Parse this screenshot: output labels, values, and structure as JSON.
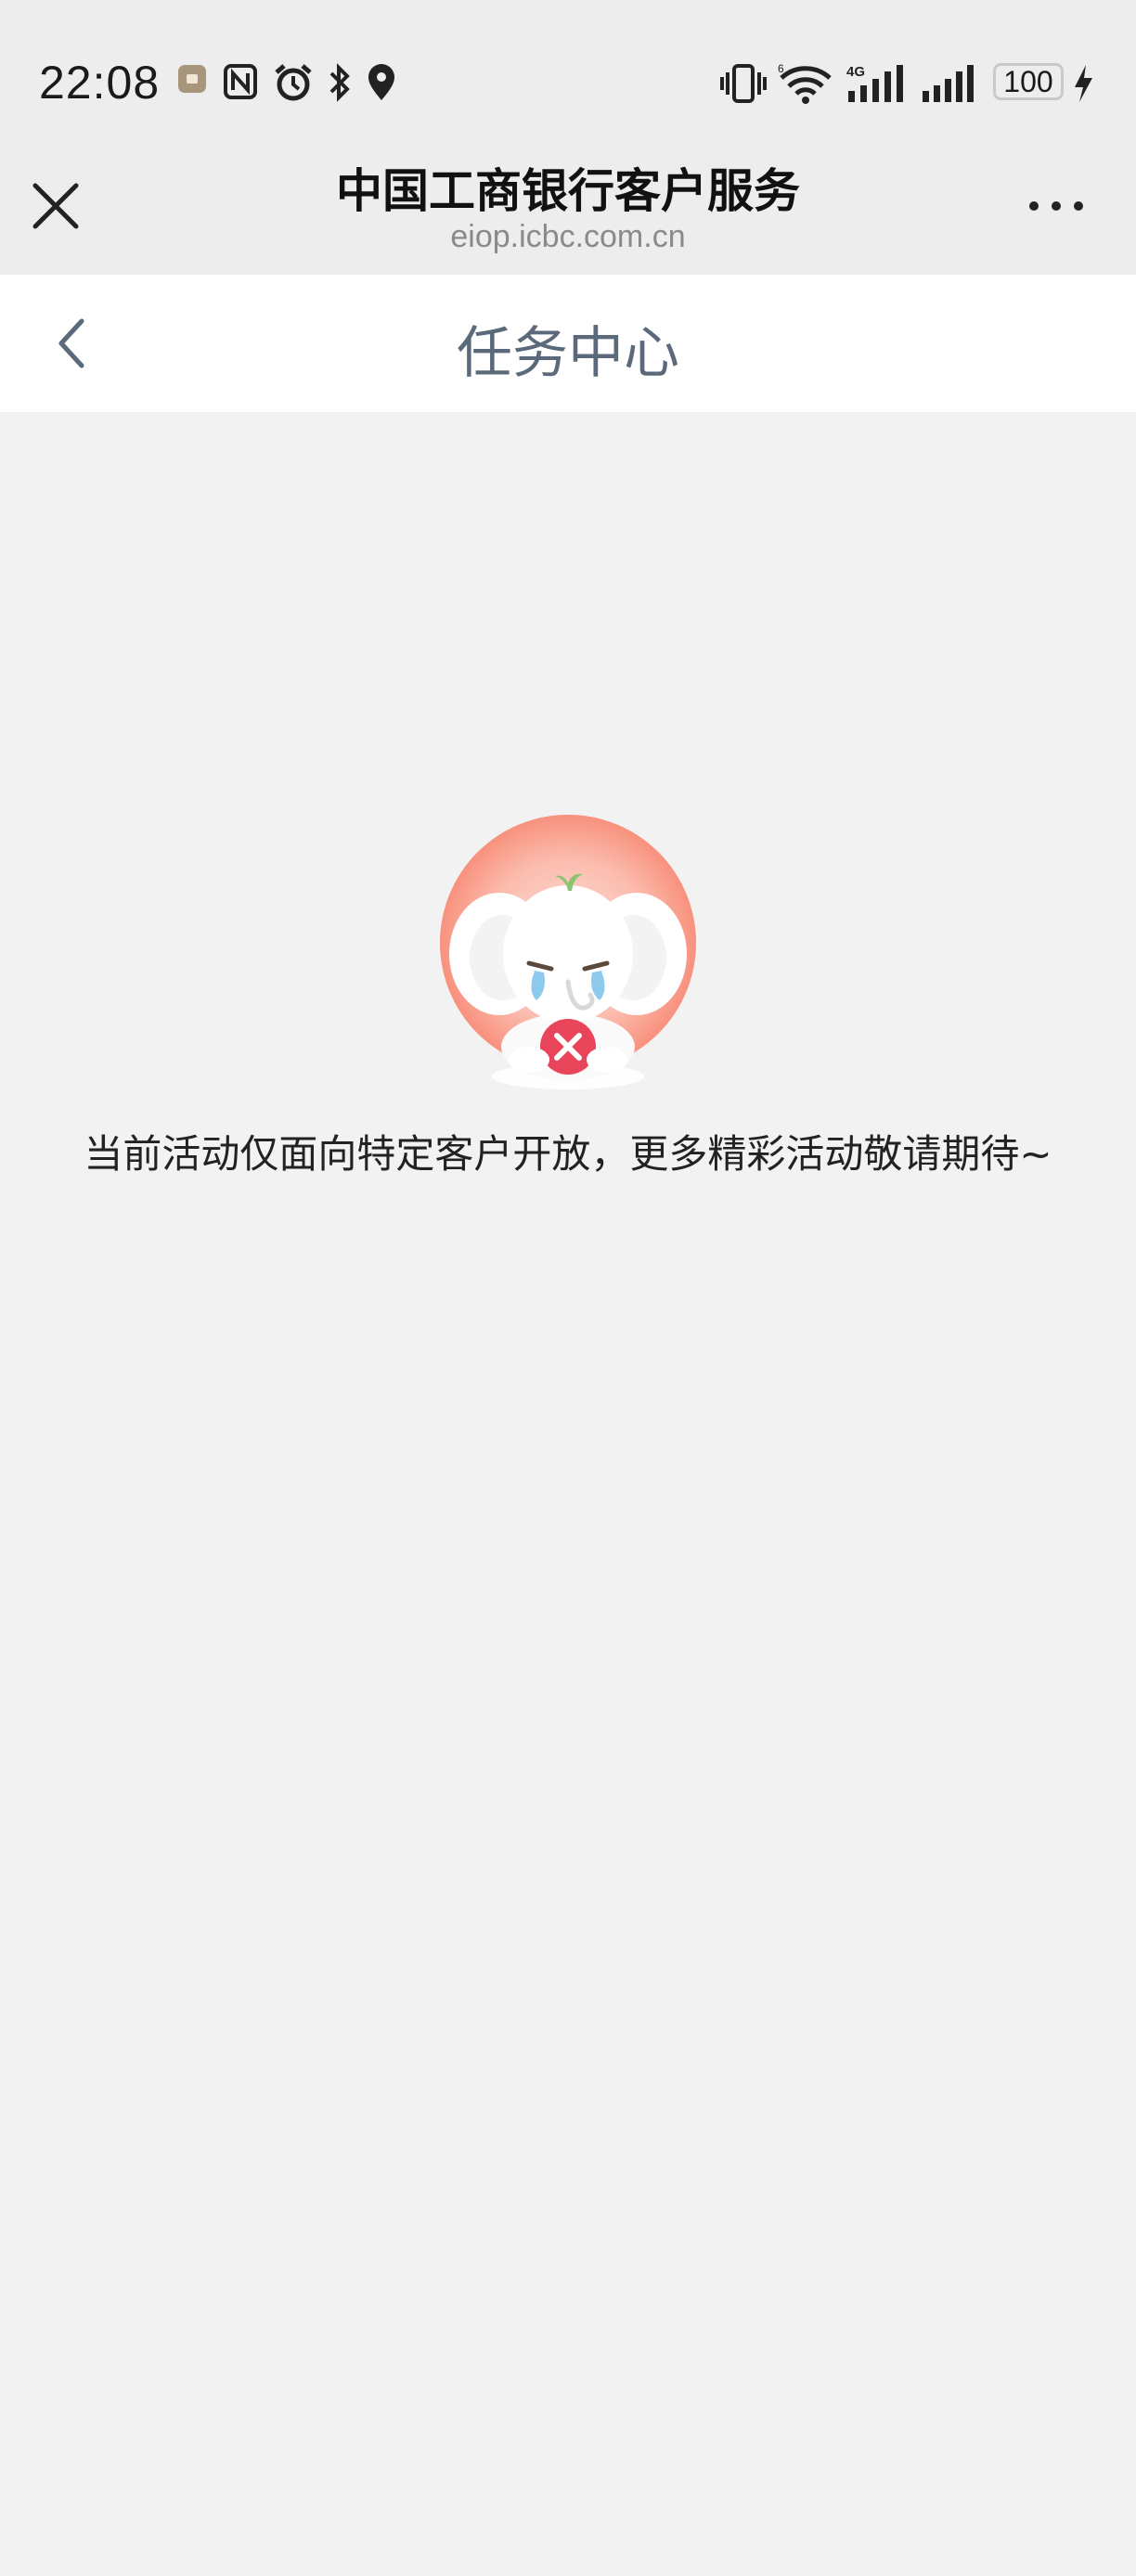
{
  "status_bar": {
    "time": "22:08",
    "battery": "100",
    "network": "4G",
    "icons": [
      "notification-app-icon",
      "nfc-icon",
      "alarm-icon",
      "bluetooth-icon",
      "location-icon",
      "vibrate-icon",
      "wifi-icon",
      "signal-icon",
      "signal-icon",
      "battery-icon",
      "charging-icon"
    ]
  },
  "browser": {
    "title": "中国工商银行客户服务",
    "url": "eiop.icbc.com.cn"
  },
  "nav": {
    "title": "任务中心"
  },
  "empty_state": {
    "message": "当前活动仅面向特定客户开放，更多精彩活动敬请期待~"
  }
}
